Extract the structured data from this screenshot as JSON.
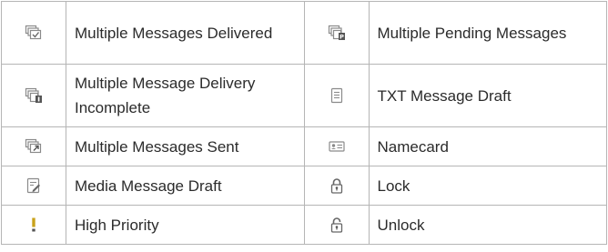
{
  "rows": [
    {
      "left": {
        "icon": "multiple-messages-delivered-icon",
        "label": "Multiple Messages Delivered"
      },
      "right": {
        "icon": "multiple-pending-messages-icon",
        "label": "Multiple Pending Messages"
      }
    },
    {
      "left": {
        "icon": "multiple-message-delivery-incomplete-icon",
        "label": "Multiple Message Delivery Incomplete"
      },
      "right": {
        "icon": "txt-message-draft-icon",
        "label": "TXT Message Draft"
      }
    },
    {
      "left": {
        "icon": "multiple-messages-sent-icon",
        "label": "Multiple Messages Sent"
      },
      "right": {
        "icon": "namecard-icon",
        "label": "Namecard"
      }
    },
    {
      "left": {
        "icon": "media-message-draft-icon",
        "label": "Media Message Draft"
      },
      "right": {
        "icon": "lock-icon",
        "label": "Lock"
      }
    },
    {
      "left": {
        "icon": "high-priority-icon",
        "label": "High Priority"
      },
      "right": {
        "icon": "unlock-icon",
        "label": "Unlock"
      }
    }
  ],
  "colors": {
    "border": "#b5b5b5",
    "icon_gray": "#8a8a8a",
    "icon_dark": "#555555",
    "priority_yellow": "#c9a21b"
  }
}
